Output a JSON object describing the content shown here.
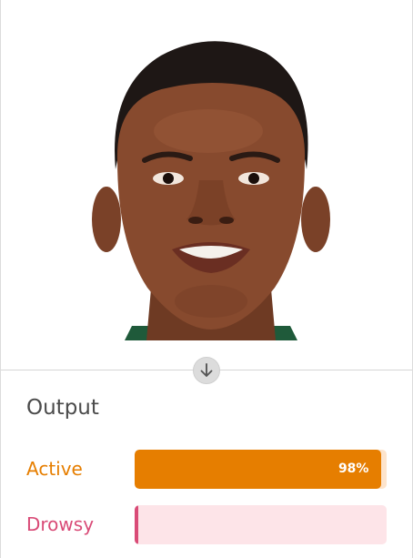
{
  "output": {
    "title": "Output",
    "results": [
      {
        "label": "Active",
        "fraction": 0.98,
        "percent_text": "98%",
        "color": "#e67e00",
        "track_color": "#fde4cc"
      },
      {
        "label": "Drowsy",
        "fraction": 0.01,
        "percent_text": "",
        "color": "#d94b77",
        "track_color": "#fde4e8"
      }
    ]
  },
  "image": {
    "alt": "face photo"
  },
  "icons": {
    "arrow": "arrow-down-icon"
  }
}
